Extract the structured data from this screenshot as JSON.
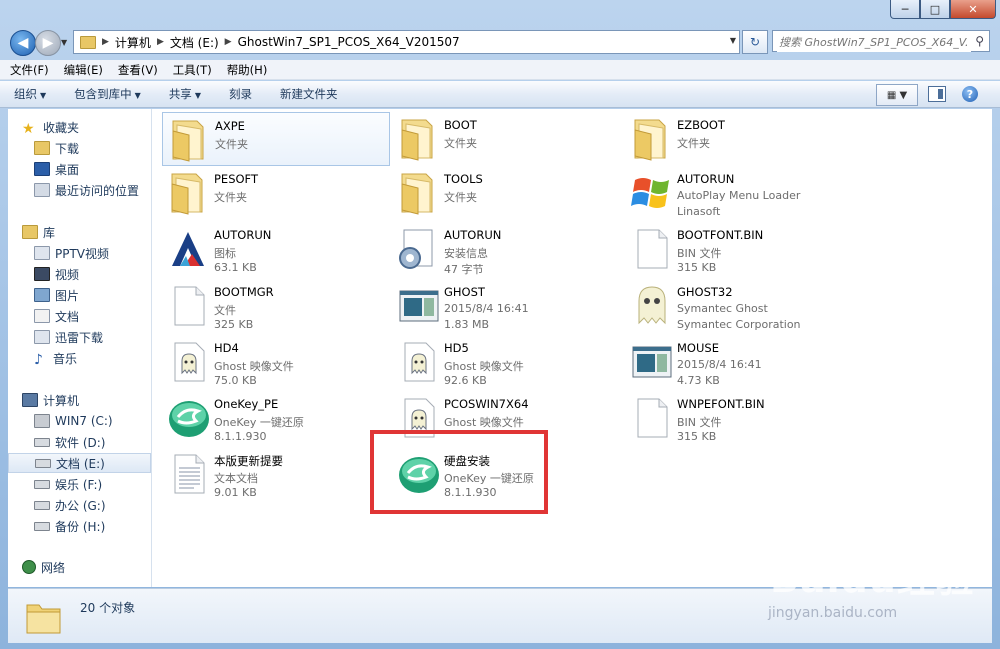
{
  "window": {
    "buttons": {
      "min": "─",
      "max": "□",
      "close": "✕"
    }
  },
  "address": {
    "path": [
      "计算机",
      "文档 (E:)",
      "GhostWin7_SP1_PCOS_X64_V201507"
    ],
    "search_placeholder": "搜索 GhostWin7_SP1_PCOS_X64_V..."
  },
  "menu": [
    "文件(F)",
    "编辑(E)",
    "查看(V)",
    "工具(T)",
    "帮助(H)"
  ],
  "commands": [
    {
      "label": "组织",
      "dropdown": true
    },
    {
      "label": "包含到库中",
      "dropdown": true
    },
    {
      "label": "共享",
      "dropdown": true
    },
    {
      "label": "刻录",
      "dropdown": false
    },
    {
      "label": "新建文件夹",
      "dropdown": false
    }
  ],
  "nav": {
    "favorites": {
      "label": "收藏夹",
      "items": [
        "下载",
        "桌面",
        "最近访问的位置"
      ]
    },
    "libraries": {
      "label": "库",
      "items": [
        "PPTV视频",
        "视频",
        "图片",
        "文档",
        "迅雷下载",
        "音乐"
      ]
    },
    "computer": {
      "label": "计算机",
      "items": [
        "WIN7 (C:)",
        "软件 (D:)",
        "文档 (E:)",
        "娱乐 (F:)",
        "办公 (G:)",
        "备份 (H:)"
      ]
    },
    "network": {
      "label": "网络"
    }
  },
  "files": [
    {
      "name": "AXPE",
      "line2": "文件夹",
      "line3": "",
      "icon": "folder-icon"
    },
    {
      "name": "BOOT",
      "line2": "文件夹",
      "line3": "",
      "icon": "folder-icon"
    },
    {
      "name": "EZBOOT",
      "line2": "文件夹",
      "line3": "",
      "icon": "folder-icon"
    },
    {
      "name": "PESOFT",
      "line2": "文件夹",
      "line3": "",
      "icon": "folder-icon"
    },
    {
      "name": "TOOLS",
      "line2": "文件夹",
      "line3": "",
      "icon": "folder-icon"
    },
    {
      "name": "AUTORUN",
      "line2": "AutoPlay Menu Loader",
      "line3": "Linasoft",
      "icon": "windows-logo-icon"
    },
    {
      "name": "AUTORUN",
      "line2": "图标",
      "line3": "63.1 KB",
      "icon": "autorun-a-icon"
    },
    {
      "name": "AUTORUN",
      "line2": "安装信息",
      "line3": "47 字节",
      "icon": "setup-gear-icon"
    },
    {
      "name": "BOOTFONT.BIN",
      "line2": "BIN 文件",
      "line3": "315 KB",
      "icon": "blank-file-icon"
    },
    {
      "name": "BOOTMGR",
      "line2": "文件",
      "line3": "325 KB",
      "icon": "blank-file-icon"
    },
    {
      "name": "GHOST",
      "line2": "2015/8/4 16:41",
      "line3": "1.83 MB",
      "icon": "app-window-icon"
    },
    {
      "name": "GHOST32",
      "line2": "Symantec Ghost",
      "line3": "Symantec Corporation",
      "icon": "ghost-icon"
    },
    {
      "name": "HD4",
      "line2": "Ghost 映像文件",
      "line3": "75.0 KB",
      "icon": "ghost-image-icon"
    },
    {
      "name": "HD5",
      "line2": "Ghost 映像文件",
      "line3": "92.6 KB",
      "icon": "ghost-image-icon"
    },
    {
      "name": "MOUSE",
      "line2": "2015/8/4 16:41",
      "line3": "4.73 KB",
      "icon": "app-window-icon"
    },
    {
      "name": "OneKey_PE",
      "line2": "OneKey 一键还原",
      "line3": "8.1.1.930",
      "icon": "onekey-icon"
    },
    {
      "name": "PCOSWIN7X64",
      "line2": "Ghost 映像文件",
      "line3": "",
      "icon": "ghost-image-icon"
    },
    {
      "name": "WNPEFONT.BIN",
      "line2": "BIN 文件",
      "line3": "315 KB",
      "icon": "blank-file-icon"
    },
    {
      "name": "本版更新提要",
      "line2": "文本文档",
      "line3": "9.01 KB",
      "icon": "text-file-icon"
    },
    {
      "name": "硬盘安装",
      "line2": "OneKey 一键还原",
      "line3": "8.1.1.930",
      "icon": "onekey-icon"
    }
  ],
  "status": {
    "count": "20 个对象"
  },
  "watermark": {
    "brand": "Baidu经验",
    "url": "jingyan.baidu.com"
  }
}
